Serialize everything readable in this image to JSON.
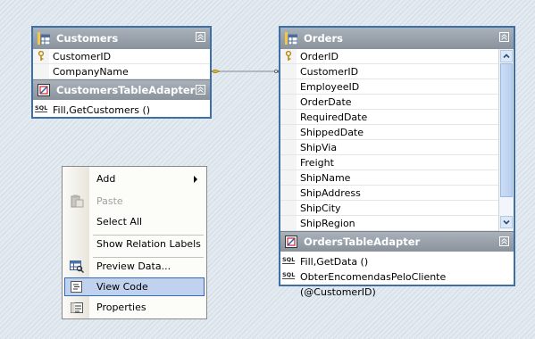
{
  "customers": {
    "title": "Customers",
    "columns": [
      "CustomerID",
      "CompanyName"
    ],
    "adapter_title": "CustomersTableAdapter",
    "methods": [
      "Fill,GetCustomers ()"
    ]
  },
  "orders": {
    "title": "Orders",
    "columns": [
      "OrderID",
      "CustomerID",
      "EmployeeID",
      "OrderDate",
      "RequiredDate",
      "ShippedDate",
      "ShipVia",
      "Freight",
      "ShipName",
      "ShipAddress",
      "ShipCity",
      "ShipRegion"
    ],
    "adapter_title": "OrdersTableAdapter",
    "methods": [
      "Fill,GetData ()",
      "ObterEncomendasPeloCliente (@CustomerID)"
    ]
  },
  "icons": {
    "table": "datatable-icon",
    "key": "primary-key-icon",
    "adapter": "tableadapter-icon",
    "sql": "sql-query-icon",
    "collapse": "collapse-chevron-icon",
    "paste": "paste-icon",
    "preview": "preview-data-icon",
    "code": "view-code-icon",
    "properties": "properties-icon"
  },
  "sql_badge": "SQL",
  "context_menu": {
    "add": "Add",
    "paste": "Paste",
    "select_all": "Select All",
    "show_relation_labels": "Show Relation Labels",
    "preview_data": "Preview Data...",
    "view_code": "View Code",
    "properties": "Properties"
  },
  "colors": {
    "border": "#3f6fa8",
    "header": "#8a939c",
    "menu_highlight": "#c1d2ee"
  }
}
